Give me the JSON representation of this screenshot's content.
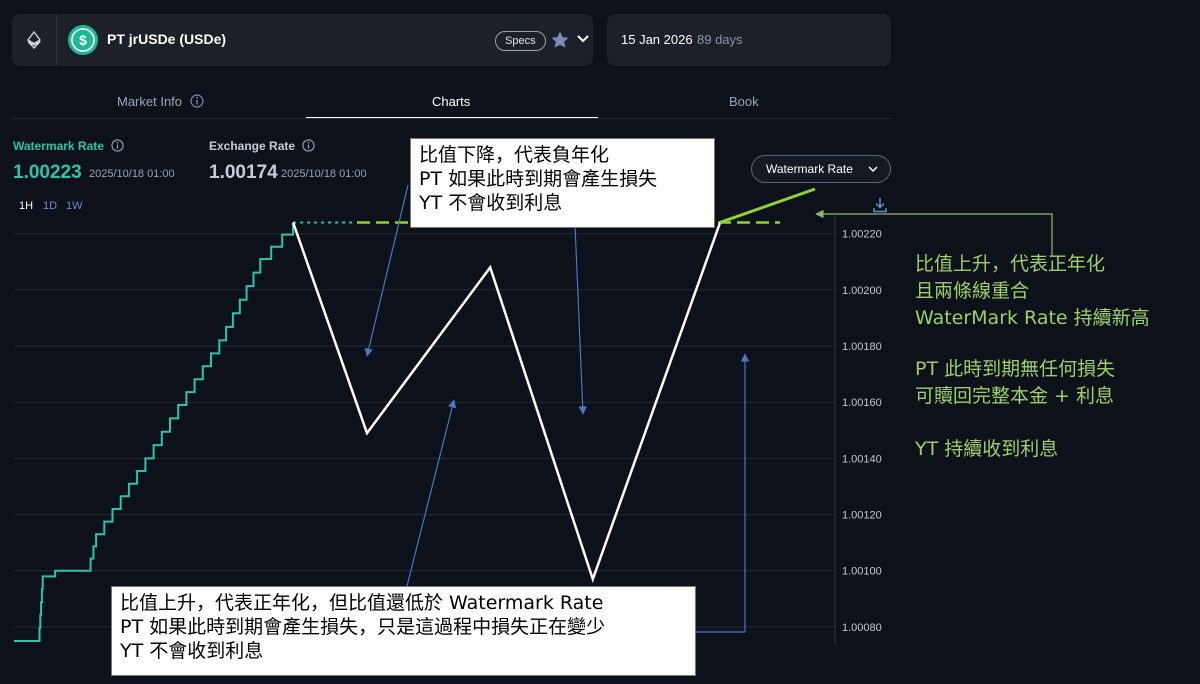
{
  "header": {
    "market_name": "PT jrUSDe (USDe)",
    "specs_label": "Specs",
    "expiry_date": "15 Jan 2026",
    "days_left": "89 days"
  },
  "tabs": [
    {
      "label": "Market Info"
    },
    {
      "label": "Charts"
    },
    {
      "label": "Book"
    }
  ],
  "stats": {
    "watermark": {
      "label": "Watermark Rate",
      "value": "1.00223",
      "time": "2025/10/18 01:00"
    },
    "exchange": {
      "label": "Exchange Rate",
      "value": "1.00174",
      "time": "2025/10/18 01:00"
    }
  },
  "timeframes": [
    "1H",
    "1D",
    "1W"
  ],
  "dropdown": {
    "label": "Watermark Rate"
  },
  "colors": {
    "watermark": "#2ec4a9",
    "annotation_green": "#8fd136",
    "annotation_white": "#ffffff",
    "side_text": "#9fcf6b"
  },
  "annotations": {
    "top_box": [
      "比值下降，代表負年化",
      "PT 如果此時到期會產生損失",
      "YT 不會收到利息"
    ],
    "bottom_box": [
      "比值上升，代表正年化，但比值還低於 Watermark Rate",
      "PT 如果此時到期會產生損失，只是這過程中損失正在變少",
      "YT 不會收到利息"
    ],
    "side": {
      "block1": [
        "比值上升，代表正年化",
        "且兩條線重合",
        "WaterMark Rate 持續新高"
      ],
      "block2": [
        "PT 此時到期無任何損失",
        "可贖回完整本金 + 利息"
      ],
      "block3": [
        "YT 持續收到利息"
      ]
    }
  },
  "chart_data": {
    "type": "line",
    "ylim": [
      1.0007,
      1.00232
    ],
    "y_ticks": [
      "1.00220",
      "1.00200",
      "1.00180",
      "1.00160",
      "1.00140",
      "1.00120",
      "1.00100",
      "1.00080"
    ],
    "series": [
      {
        "name": "Watermark Rate",
        "points": [
          [
            0,
            1.00075
          ],
          [
            0.03,
            1.00075
          ],
          [
            0.035,
            1.00098
          ],
          [
            0.05,
            1.001
          ],
          [
            0.09,
            1.001
          ],
          [
            0.1,
            1.00113
          ],
          [
            0.16,
            1.0014
          ],
          [
            0.2,
            1.00159
          ],
          [
            0.25,
            1.00182
          ],
          [
            0.3,
            1.00211
          ],
          [
            0.34,
            1.00224
          ]
        ]
      },
      {
        "name": "",
        "points": [
          [
            0.34,
            1.00224
          ],
          [
            0.43,
            1.00149
          ],
          [
            0.58,
            1.00208
          ],
          [
            0.705,
            1.00097
          ],
          [
            0.86,
            1.00224
          ]
        ]
      }
    ]
  }
}
